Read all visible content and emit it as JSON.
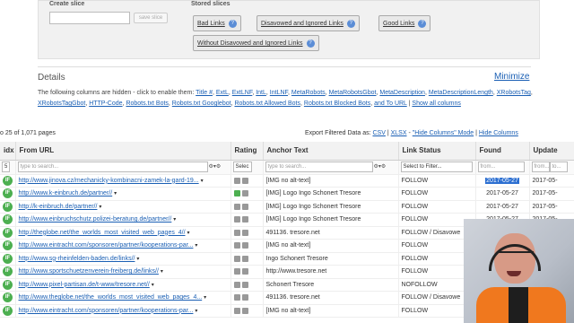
{
  "slices": {
    "create_label": "Create slice",
    "save_label": "save slice",
    "stored_label": "Stored slices",
    "stored": [
      "Bad Links",
      "Disavowed and Ignored Links",
      "Good Links",
      "Without Disavowed and Ignored Links"
    ]
  },
  "details": {
    "title": "Details",
    "minimize": "Minimize",
    "hidden_intro": "The following columns are hidden - click to enable them:",
    "hidden_columns": [
      "Title #",
      "ExtL",
      "ExtLNF",
      "IntL",
      "IntLNF",
      "MetaRobots",
      "MetaRobotsGbot",
      "MetaDescription",
      "MetaDescriptionLength",
      "XRobotsTag",
      "XRobotsTagGbot",
      "HTTP-Code",
      "Robots.txt Bots",
      "Robots.txt Googlebot",
      "Robots.txt Allowed Bots",
      "Robots.txt Blocked Bots",
      "and To URL"
    ],
    "show_all": "Show all columns"
  },
  "pager": {
    "text": "o 25 of 1,071 pages"
  },
  "export": {
    "label": "Export Filtered Data as:",
    "csv": "CSV",
    "xlsx": "XLSX",
    "hide_mode": "\"Hide Columns\" Mode",
    "hide_columns": "Hide Columns"
  },
  "table": {
    "headers": {
      "idx": "idx",
      "from_url": "From URL",
      "rating": "Rating",
      "anchor": "Anchor Text",
      "status": "Link Status",
      "found": "Found",
      "update": "Update"
    },
    "filters": {
      "idx_value": "5",
      "search_placeholder": "type to search...",
      "rating_value": "Selec",
      "status_value": "Select to Filter...",
      "from_placeholder": "from...",
      "to_placeholder": "to..."
    },
    "rows": [
      {
        "badge": "IF",
        "url": "http://www.jinova.cz/mechanicky-kombinacni-zamek-la-gard-19...",
        "up": false,
        "anchor": "[IMG no alt-text]",
        "status": "FOLLOW",
        "found": "2017-05-27",
        "update": "2017-05-",
        "selected": true
      },
      {
        "badge": "IF",
        "url": "http://www.k-einbruch.de/partner//",
        "up": true,
        "anchor": "[IMG] Logo Ingo Schonert Tresore",
        "status": "FOLLOW",
        "found": "2017-05-27",
        "update": "2017-05-",
        "selected": false
      },
      {
        "badge": "IF",
        "url": "http://k-einbruch.de/partner//",
        "up": false,
        "anchor": "[IMG] Logo Ingo Schonert Tresore",
        "status": "FOLLOW",
        "found": "2017-05-27",
        "update": "2017-05-",
        "selected": false
      },
      {
        "badge": "IF",
        "url": "http://www.einbruchschutz.polizei-beratung.de/partner//",
        "up": false,
        "anchor": "[IMG] Logo Ingo Schonert Tresore",
        "status": "FOLLOW",
        "found": "2017-05-27",
        "update": "2017-05-",
        "selected": false
      },
      {
        "badge": "IF",
        "url": "http://theglobe.net/the_worlds_most_visited_web_pages_4//",
        "up": false,
        "anchor": "491136. tresore.net",
        "status": "FOLLOW / Disavowe",
        "found": "",
        "update": "",
        "selected": false
      },
      {
        "badge": "IF",
        "url": "http://www.eintracht.com/sponsoren/partner/kooperations-par...",
        "up": false,
        "anchor": "[IMG no alt-text]",
        "status": "FOLLOW",
        "found": "",
        "update": "",
        "selected": false
      },
      {
        "badge": "IF",
        "url": "http://www.sg-rheinfelden-baden.de/links//",
        "up": false,
        "anchor": "Ingo Schonert Tresore",
        "status": "FOLLOW",
        "found": "",
        "update": "",
        "selected": false
      },
      {
        "badge": "IF",
        "url": "http://www.sportschuetzenverein-freiberg.de/links//",
        "up": false,
        "anchor": "http://www.tresore.net",
        "status": "FOLLOW",
        "found": "",
        "update": "",
        "selected": false
      },
      {
        "badge": "IF",
        "url": "http://www.pixel-partisan.de/t-www/tresore.net//",
        "up": false,
        "anchor": "Schonert Tresore",
        "status": "NOFOLLOW",
        "found": "",
        "update": "",
        "selected": false
      },
      {
        "badge": "IF",
        "url": "http://www.theglobe.net/the_worlds_most_visited_web_pages_4...",
        "up": false,
        "anchor": "491136. tresore.net",
        "status": "FOLLOW / Disavowe",
        "found": "",
        "update": "",
        "selected": false
      },
      {
        "badge": "IF",
        "url": "http://www.eintracht.com/sponsoren/partner/kooperations-par...",
        "up": false,
        "anchor": "[IMG no alt-text]",
        "status": "FOLLOW",
        "found": "",
        "update": "",
        "selected": false
      }
    ]
  },
  "colors": {
    "link": "#1a5fb4",
    "badge": "#4caf50",
    "selection": "#2c6fd1",
    "shirt": "#f0781e"
  }
}
